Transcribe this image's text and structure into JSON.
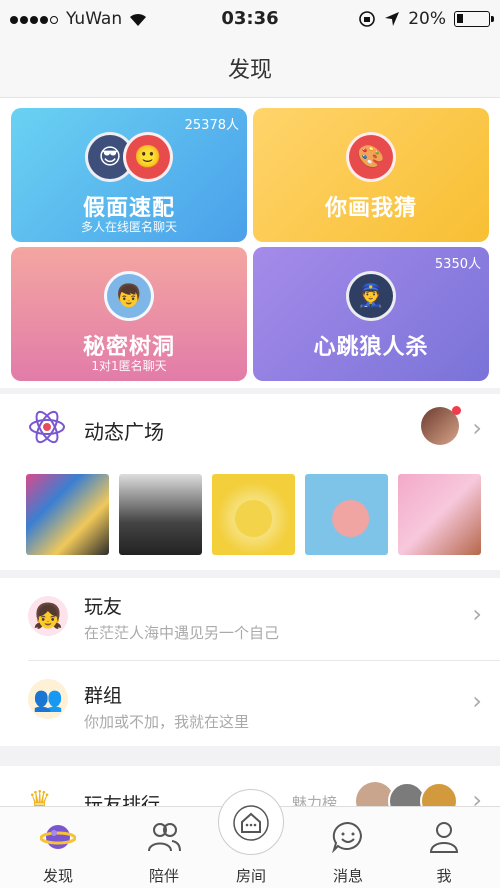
{
  "status_bar": {
    "carrier": "YuWan",
    "time": "03:36",
    "battery": "20%",
    "battery_level": 0.2
  },
  "nav": {
    "title": "发现"
  },
  "cards": [
    {
      "title": "假面速配",
      "subtitle": "多人在线匿名聊天",
      "count": "25378人"
    },
    {
      "title": "你画我猜",
      "subtitle": "",
      "count": ""
    },
    {
      "title": "秘密树洞",
      "subtitle": "1对1匿名聊天",
      "count": ""
    },
    {
      "title": "心跳狼人杀",
      "subtitle": "",
      "count": "5350人"
    }
  ],
  "feed": {
    "title": "动态广场"
  },
  "list": [
    {
      "title": "玩友",
      "subtitle": "在茫茫人海中遇见另一个自己"
    },
    {
      "title": "群组",
      "subtitle": "你加或不加，我就在这里"
    }
  ],
  "ranking": {
    "title": "玩友排行",
    "tag": "魅力榜"
  },
  "tabs": [
    {
      "label": "发现",
      "icon": "planet-icon"
    },
    {
      "label": "陪伴",
      "icon": "people-icon"
    },
    {
      "label": "房间",
      "icon": "house-icon"
    },
    {
      "label": "消息",
      "icon": "chat-icon"
    },
    {
      "label": "我",
      "icon": "person-icon"
    }
  ],
  "colors": {
    "accent": "#7a57d1",
    "card1": "#5ab9ef",
    "card2": "#fbc94b",
    "card3": "#e992a8",
    "card4": "#8e7ee2"
  }
}
